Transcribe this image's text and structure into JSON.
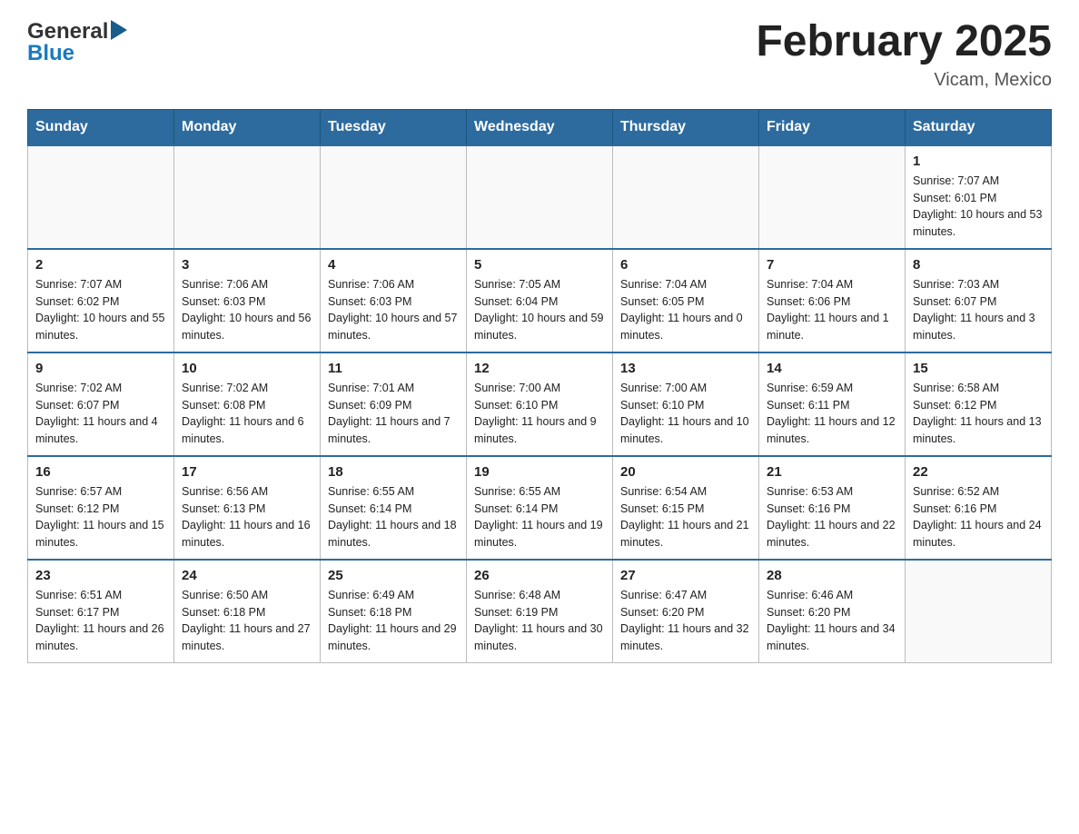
{
  "header": {
    "logo_general": "General",
    "logo_blue": "Blue",
    "month_title": "February 2025",
    "location": "Vicam, Mexico"
  },
  "weekdays": [
    "Sunday",
    "Monday",
    "Tuesday",
    "Wednesday",
    "Thursday",
    "Friday",
    "Saturday"
  ],
  "weeks": [
    [
      {
        "day": "",
        "sunrise": "",
        "sunset": "",
        "daylight": ""
      },
      {
        "day": "",
        "sunrise": "",
        "sunset": "",
        "daylight": ""
      },
      {
        "day": "",
        "sunrise": "",
        "sunset": "",
        "daylight": ""
      },
      {
        "day": "",
        "sunrise": "",
        "sunset": "",
        "daylight": ""
      },
      {
        "day": "",
        "sunrise": "",
        "sunset": "",
        "daylight": ""
      },
      {
        "day": "",
        "sunrise": "",
        "sunset": "",
        "daylight": ""
      },
      {
        "day": "1",
        "sunrise": "Sunrise: 7:07 AM",
        "sunset": "Sunset: 6:01 PM",
        "daylight": "Daylight: 10 hours and 53 minutes."
      }
    ],
    [
      {
        "day": "2",
        "sunrise": "Sunrise: 7:07 AM",
        "sunset": "Sunset: 6:02 PM",
        "daylight": "Daylight: 10 hours and 55 minutes."
      },
      {
        "day": "3",
        "sunrise": "Sunrise: 7:06 AM",
        "sunset": "Sunset: 6:03 PM",
        "daylight": "Daylight: 10 hours and 56 minutes."
      },
      {
        "day": "4",
        "sunrise": "Sunrise: 7:06 AM",
        "sunset": "Sunset: 6:03 PM",
        "daylight": "Daylight: 10 hours and 57 minutes."
      },
      {
        "day": "5",
        "sunrise": "Sunrise: 7:05 AM",
        "sunset": "Sunset: 6:04 PM",
        "daylight": "Daylight: 10 hours and 59 minutes."
      },
      {
        "day": "6",
        "sunrise": "Sunrise: 7:04 AM",
        "sunset": "Sunset: 6:05 PM",
        "daylight": "Daylight: 11 hours and 0 minutes."
      },
      {
        "day": "7",
        "sunrise": "Sunrise: 7:04 AM",
        "sunset": "Sunset: 6:06 PM",
        "daylight": "Daylight: 11 hours and 1 minute."
      },
      {
        "day": "8",
        "sunrise": "Sunrise: 7:03 AM",
        "sunset": "Sunset: 6:07 PM",
        "daylight": "Daylight: 11 hours and 3 minutes."
      }
    ],
    [
      {
        "day": "9",
        "sunrise": "Sunrise: 7:02 AM",
        "sunset": "Sunset: 6:07 PM",
        "daylight": "Daylight: 11 hours and 4 minutes."
      },
      {
        "day": "10",
        "sunrise": "Sunrise: 7:02 AM",
        "sunset": "Sunset: 6:08 PM",
        "daylight": "Daylight: 11 hours and 6 minutes."
      },
      {
        "day": "11",
        "sunrise": "Sunrise: 7:01 AM",
        "sunset": "Sunset: 6:09 PM",
        "daylight": "Daylight: 11 hours and 7 minutes."
      },
      {
        "day": "12",
        "sunrise": "Sunrise: 7:00 AM",
        "sunset": "Sunset: 6:10 PM",
        "daylight": "Daylight: 11 hours and 9 minutes."
      },
      {
        "day": "13",
        "sunrise": "Sunrise: 7:00 AM",
        "sunset": "Sunset: 6:10 PM",
        "daylight": "Daylight: 11 hours and 10 minutes."
      },
      {
        "day": "14",
        "sunrise": "Sunrise: 6:59 AM",
        "sunset": "Sunset: 6:11 PM",
        "daylight": "Daylight: 11 hours and 12 minutes."
      },
      {
        "day": "15",
        "sunrise": "Sunrise: 6:58 AM",
        "sunset": "Sunset: 6:12 PM",
        "daylight": "Daylight: 11 hours and 13 minutes."
      }
    ],
    [
      {
        "day": "16",
        "sunrise": "Sunrise: 6:57 AM",
        "sunset": "Sunset: 6:12 PM",
        "daylight": "Daylight: 11 hours and 15 minutes."
      },
      {
        "day": "17",
        "sunrise": "Sunrise: 6:56 AM",
        "sunset": "Sunset: 6:13 PM",
        "daylight": "Daylight: 11 hours and 16 minutes."
      },
      {
        "day": "18",
        "sunrise": "Sunrise: 6:55 AM",
        "sunset": "Sunset: 6:14 PM",
        "daylight": "Daylight: 11 hours and 18 minutes."
      },
      {
        "day": "19",
        "sunrise": "Sunrise: 6:55 AM",
        "sunset": "Sunset: 6:14 PM",
        "daylight": "Daylight: 11 hours and 19 minutes."
      },
      {
        "day": "20",
        "sunrise": "Sunrise: 6:54 AM",
        "sunset": "Sunset: 6:15 PM",
        "daylight": "Daylight: 11 hours and 21 minutes."
      },
      {
        "day": "21",
        "sunrise": "Sunrise: 6:53 AM",
        "sunset": "Sunset: 6:16 PM",
        "daylight": "Daylight: 11 hours and 22 minutes."
      },
      {
        "day": "22",
        "sunrise": "Sunrise: 6:52 AM",
        "sunset": "Sunset: 6:16 PM",
        "daylight": "Daylight: 11 hours and 24 minutes."
      }
    ],
    [
      {
        "day": "23",
        "sunrise": "Sunrise: 6:51 AM",
        "sunset": "Sunset: 6:17 PM",
        "daylight": "Daylight: 11 hours and 26 minutes."
      },
      {
        "day": "24",
        "sunrise": "Sunrise: 6:50 AM",
        "sunset": "Sunset: 6:18 PM",
        "daylight": "Daylight: 11 hours and 27 minutes."
      },
      {
        "day": "25",
        "sunrise": "Sunrise: 6:49 AM",
        "sunset": "Sunset: 6:18 PM",
        "daylight": "Daylight: 11 hours and 29 minutes."
      },
      {
        "day": "26",
        "sunrise": "Sunrise: 6:48 AM",
        "sunset": "Sunset: 6:19 PM",
        "daylight": "Daylight: 11 hours and 30 minutes."
      },
      {
        "day": "27",
        "sunrise": "Sunrise: 6:47 AM",
        "sunset": "Sunset: 6:20 PM",
        "daylight": "Daylight: 11 hours and 32 minutes."
      },
      {
        "day": "28",
        "sunrise": "Sunrise: 6:46 AM",
        "sunset": "Sunset: 6:20 PM",
        "daylight": "Daylight: 11 hours and 34 minutes."
      },
      {
        "day": "",
        "sunrise": "",
        "sunset": "",
        "daylight": ""
      }
    ]
  ]
}
